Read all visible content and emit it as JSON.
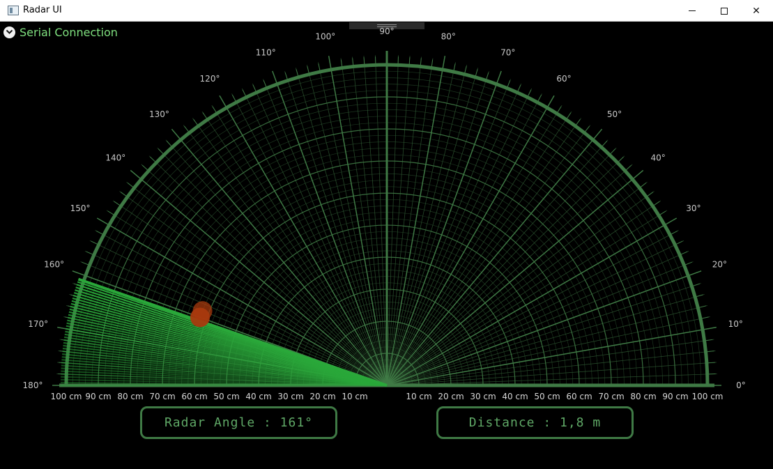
{
  "window": {
    "title": "Radar UI",
    "controls": {
      "minimize": "minimize",
      "maximize": "maximize",
      "close": "✕"
    }
  },
  "panel": {
    "serial_label": "Serial Connection"
  },
  "radar": {
    "angle_labels": [
      "0°",
      "10°",
      "20°",
      "30°",
      "40°",
      "50°",
      "60°",
      "70°",
      "80°",
      "90°",
      "100°",
      "110°",
      "120°",
      "130°",
      "140°",
      "150°",
      "160°",
      "170°",
      "180°"
    ],
    "left_distance_labels": [
      "100 cm",
      "90 cm",
      "80 cm",
      "70 cm",
      "60 cm",
      "50 cm",
      "40 cm",
      "30 cm",
      "20 cm",
      "10 cm"
    ],
    "right_distance_labels": [
      "10 cm",
      "20 cm",
      "30 cm",
      "40 cm",
      "50 cm",
      "60 cm",
      "70 cm",
      "80 cm",
      "90 cm",
      "100 cm"
    ],
    "sweep_angle_deg": 161,
    "objects": [
      {
        "angle_deg": 160,
        "distance_cm": 62
      },
      {
        "angle_deg": 158,
        "distance_cm": 62
      }
    ],
    "colors": {
      "grid": "#3f7a45",
      "grid_fine": "#2f5a33",
      "sweep": "#2aa83a",
      "object": "#a83a0e"
    }
  },
  "readouts": {
    "angle_text": "Radar Angle : 161°",
    "distance_text": "Distance : 1,8 m"
  }
}
